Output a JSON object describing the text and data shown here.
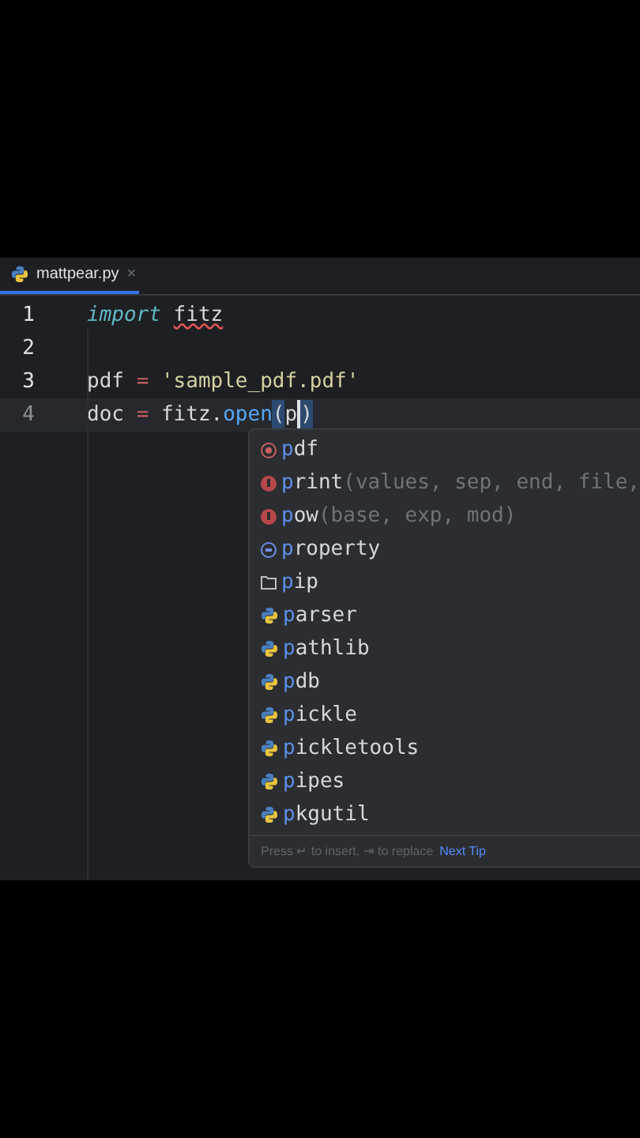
{
  "tabs": [
    {
      "label": "mattpear.py",
      "close": "×",
      "selected": true
    }
  ],
  "code_lines": [
    {
      "number": "1",
      "current": false,
      "tokens": [
        {
          "text": "import ",
          "kind": "keyword"
        },
        {
          "text": "fitz",
          "kind": "plain",
          "error": true
        }
      ]
    },
    {
      "number": "2",
      "current": false
    },
    {
      "number": "3",
      "current": false,
      "tokens": [
        {
          "text": "pdf ",
          "kind": "plain"
        },
        {
          "text": "= ",
          "kind": "operator"
        },
        {
          "text": "'sample_pdf.pdf'",
          "kind": "string"
        }
      ]
    },
    {
      "number": "4",
      "current": true,
      "tokens": [
        {
          "text": "doc ",
          "kind": "plain"
        },
        {
          "text": "=",
          "kind": "operator"
        },
        {
          "text": " fitz.",
          "kind": "plain"
        },
        {
          "text": "open",
          "kind": "method"
        },
        {
          "text": "(",
          "kind": "brace",
          "matched": true
        },
        {
          "text": "p",
          "kind": "plain",
          "caret": true
        },
        {
          "text": ")",
          "kind": "brace",
          "matched": true
        }
      ]
    }
  ],
  "completion": {
    "items": [
      {
        "name": "pdf",
        "kind": "variable",
        "selected": false
      },
      {
        "name": "print",
        "params": "(values, sep, end, file,",
        "kind": "function",
        "selected": false
      },
      {
        "name": "pow",
        "params": "(base, exp, mod)",
        "kind": "function",
        "selected": false
      },
      {
        "name": "property",
        "kind": "class",
        "selected": false
      },
      {
        "name": "pip",
        "kind": "package",
        "selected": false
      },
      {
        "name": "parser",
        "kind": "module",
        "selected": false
      },
      {
        "name": "pathlib",
        "kind": "module",
        "selected": false
      },
      {
        "name": "pdb",
        "kind": "module",
        "selected": false
      },
      {
        "name": "pickle",
        "kind": "module",
        "selected": false
      },
      {
        "name": "pickletools",
        "kind": "module",
        "selected": false
      },
      {
        "name": "pipes",
        "kind": "module",
        "selected": false
      },
      {
        "name": "pkgutil",
        "kind": "module",
        "selected": false
      }
    ],
    "hint": "Press ↵ to insert, ⇥ to replace",
    "next_tip": "Next Tip"
  }
}
